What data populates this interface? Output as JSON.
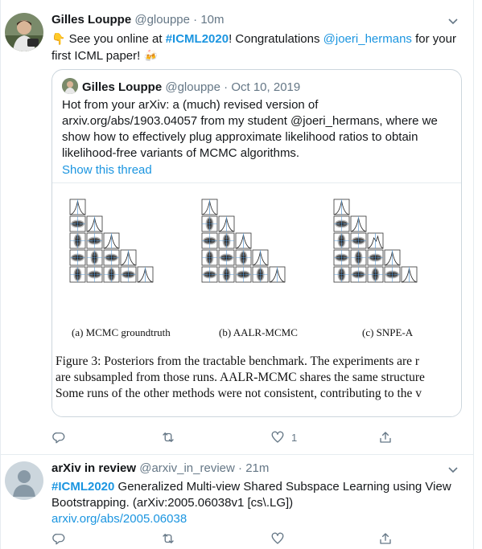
{
  "tweets": [
    {
      "author": "Gilles Louppe",
      "handle": "@glouppe",
      "sep": "·",
      "time": "10m",
      "text_pre_emoji": "👇",
      "text_1": " See you online at ",
      "hashtag": "#ICML2020",
      "text_2": "! Congratulations ",
      "mention": "@joeri_hermans",
      "text_3": " for your first ICML paper! ",
      "text_post_emoji": "🍻",
      "quote": {
        "author": "Gilles Louppe",
        "handle": "@glouppe",
        "sep": "·",
        "date": "Oct 10, 2019",
        "text": "Hot from your arXiv: a (much) revised version of arxiv.org/abs/1903.04057 from my student @joeri_hermans, where we show how to effectively plug approximate likelihood ratios to obtain likelihood-free variants of MCMC algorithms.",
        "show_thread": "Show this thread",
        "figure": {
          "captions": [
            "(a) MCMC groundtruth",
            "(b) AALR-MCMC",
            "(c) SNPE-A"
          ],
          "lines": [
            "Figure 3: Posteriors from the tractable benchmark. The experiments are r",
            "are subsampled from those runs. AALR-MCMC shares the same structure",
            "Some runs of the other methods were not consistent, contributing to the v"
          ]
        }
      },
      "actions": {
        "reply_count": "",
        "retweet_count": "",
        "like_count": "1"
      }
    },
    {
      "author": "arXiv in review",
      "handle": "@arxiv_in_review",
      "sep": "·",
      "time": "21m",
      "hashtag": "#ICML2020",
      "text": " Generalized Multi-view Shared Subspace Learning using View Bootstrapping. (arXiv:2005.06038v1 [cs\\.LG])",
      "link": "arxiv.org/abs/2005.06038",
      "actions": {
        "reply_count": "",
        "retweet_count": "",
        "like_count": ""
      }
    }
  ],
  "colors": {
    "accent": "#1b95e0",
    "muted": "#657786",
    "border": "#e6ecf0"
  },
  "icons": [
    "reply-icon",
    "retweet-icon",
    "like-icon",
    "share-icon",
    "chevron-down-icon"
  ]
}
